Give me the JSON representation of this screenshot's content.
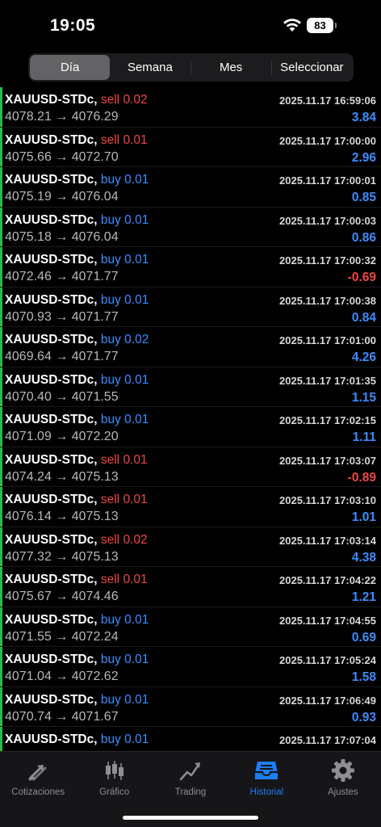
{
  "status": {
    "time": "19:05",
    "battery": "83"
  },
  "segments": [
    {
      "label": "Día",
      "active": true
    },
    {
      "label": "Semana",
      "active": false
    },
    {
      "label": "Mes",
      "active": false
    },
    {
      "label": "Seleccionar",
      "active": false
    }
  ],
  "arrow": "→",
  "trades": [
    {
      "symbol": "XAUUSD-STDc,",
      "side": "sell",
      "volume": "0.02",
      "open": "4078.21",
      "close": "4076.29",
      "datetime": "2025.11.17 16:59:06",
      "profit": "3.84"
    },
    {
      "symbol": "XAUUSD-STDc,",
      "side": "sell",
      "volume": "0.01",
      "open": "4075.66",
      "close": "4072.70",
      "datetime": "2025.11.17 17:00:00",
      "profit": "2.96"
    },
    {
      "symbol": "XAUUSD-STDc,",
      "side": "buy",
      "volume": "0.01",
      "open": "4075.19",
      "close": "4076.04",
      "datetime": "2025.11.17 17:00:01",
      "profit": "0.85"
    },
    {
      "symbol": "XAUUSD-STDc,",
      "side": "buy",
      "volume": "0.01",
      "open": "4075.18",
      "close": "4076.04",
      "datetime": "2025.11.17 17:00:03",
      "profit": "0.86"
    },
    {
      "symbol": "XAUUSD-STDc,",
      "side": "buy",
      "volume": "0.01",
      "open": "4072.46",
      "close": "4071.77",
      "datetime": "2025.11.17 17:00:32",
      "profit": "-0.69"
    },
    {
      "symbol": "XAUUSD-STDc,",
      "side": "buy",
      "volume": "0.01",
      "open": "4070.93",
      "close": "4071.77",
      "datetime": "2025.11.17 17:00:38",
      "profit": "0.84"
    },
    {
      "symbol": "XAUUSD-STDc,",
      "side": "buy",
      "volume": "0.02",
      "open": "4069.64",
      "close": "4071.77",
      "datetime": "2025.11.17 17:01:00",
      "profit": "4.26"
    },
    {
      "symbol": "XAUUSD-STDc,",
      "side": "buy",
      "volume": "0.01",
      "open": "4070.40",
      "close": "4071.55",
      "datetime": "2025.11.17 17:01:35",
      "profit": "1.15"
    },
    {
      "symbol": "XAUUSD-STDc,",
      "side": "buy",
      "volume": "0.01",
      "open": "4071.09",
      "close": "4072.20",
      "datetime": "2025.11.17 17:02:15",
      "profit": "1.11"
    },
    {
      "symbol": "XAUUSD-STDc,",
      "side": "sell",
      "volume": "0.01",
      "open": "4074.24",
      "close": "4075.13",
      "datetime": "2025.11.17 17:03:07",
      "profit": "-0.89"
    },
    {
      "symbol": "XAUUSD-STDc,",
      "side": "sell",
      "volume": "0.01",
      "open": "4076.14",
      "close": "4075.13",
      "datetime": "2025.11.17 17:03:10",
      "profit": "1.01"
    },
    {
      "symbol": "XAUUSD-STDc,",
      "side": "sell",
      "volume": "0.02",
      "open": "4077.32",
      "close": "4075.13",
      "datetime": "2025.11.17 17:03:14",
      "profit": "4.38"
    },
    {
      "symbol": "XAUUSD-STDc,",
      "side": "sell",
      "volume": "0.01",
      "open": "4075.67",
      "close": "4074.46",
      "datetime": "2025.11.17 17:04:22",
      "profit": "1.21"
    },
    {
      "symbol": "XAUUSD-STDc,",
      "side": "buy",
      "volume": "0.01",
      "open": "4071.55",
      "close": "4072.24",
      "datetime": "2025.11.17 17:04:55",
      "profit": "0.69"
    },
    {
      "symbol": "XAUUSD-STDc,",
      "side": "buy",
      "volume": "0.01",
      "open": "4071.04",
      "close": "4072.62",
      "datetime": "2025.11.17 17:05:24",
      "profit": "1.58"
    },
    {
      "symbol": "XAUUSD-STDc,",
      "side": "buy",
      "volume": "0.01",
      "open": "4070.74",
      "close": "4071.67",
      "datetime": "2025.11.17 17:06:49",
      "profit": "0.93"
    },
    {
      "symbol": "XAUUSD-STDc,",
      "side": "buy",
      "volume": "0.01",
      "open": "",
      "close": "",
      "datetime": "2025.11.17 17:07:04",
      "profit": ""
    }
  ],
  "tabs": [
    {
      "label": "Cotizaciones",
      "icon": "quotes-icon",
      "active": false
    },
    {
      "label": "Gráfico",
      "icon": "candlestick-chart-icon",
      "active": false
    },
    {
      "label": "Trading",
      "icon": "trading-icon",
      "active": false
    },
    {
      "label": "Historial",
      "icon": "inbox-history-icon",
      "active": true
    },
    {
      "label": "Ajustes",
      "icon": "gear-icon",
      "active": false
    }
  ],
  "colors": {
    "sell": "#f04545",
    "buy": "#3a8dff",
    "accent": "#1e7ef5",
    "row_bar": "#2db84d"
  }
}
